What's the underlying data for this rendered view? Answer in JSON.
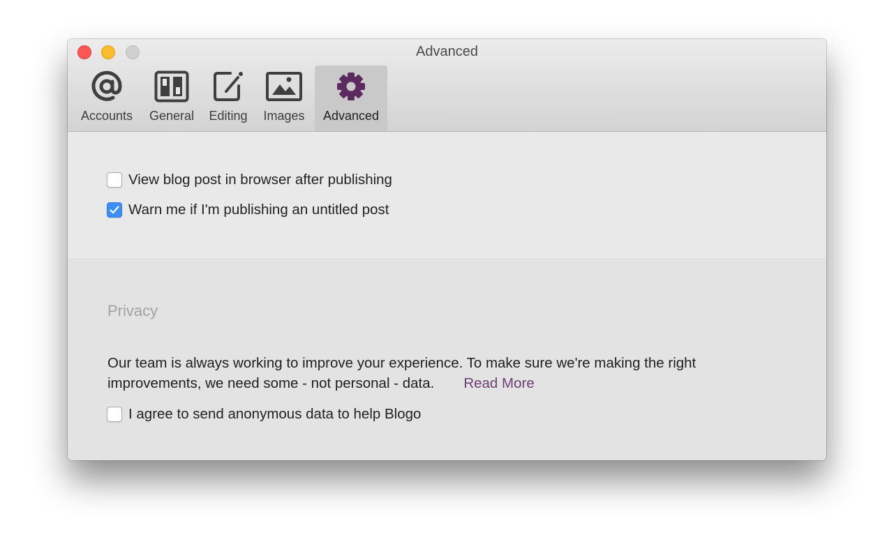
{
  "window": {
    "title": "Advanced",
    "controls": [
      "close",
      "minimize",
      "zoom"
    ]
  },
  "toolbar": {
    "tabs": [
      {
        "label": "Accounts",
        "icon": "at-icon",
        "active": false
      },
      {
        "label": "General",
        "icon": "layout-icon",
        "active": false
      },
      {
        "label": "Editing",
        "icon": "edit-icon",
        "active": false
      },
      {
        "label": "Images",
        "icon": "image-icon",
        "active": false
      },
      {
        "label": "Advanced",
        "icon": "gear-icon",
        "active": true
      }
    ]
  },
  "options": {
    "view_after_publish": {
      "label": "View blog post in browser after publishing",
      "checked": false
    },
    "warn_untitled": {
      "label": "Warn me if I'm publishing an untitled post",
      "checked": true
    }
  },
  "privacy": {
    "heading": "Privacy",
    "text": "Our team is always working to improve your experience. To make sure we're making the right improvements, we need some - not personal - data.",
    "read_more": "Read More",
    "agree": {
      "label": "I agree to send anonymous data to help Blogo",
      "checked": false
    }
  },
  "colors": {
    "accent_purple": "#5b2a5e",
    "link_purple": "#6d3f73",
    "checkbox_blue": "#3d8ff7"
  }
}
